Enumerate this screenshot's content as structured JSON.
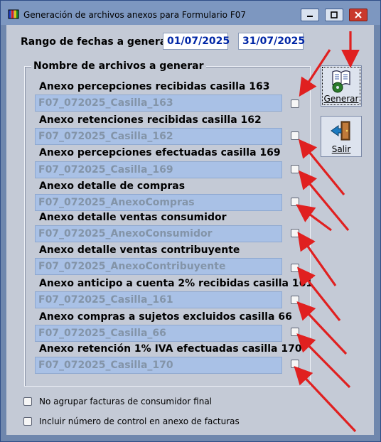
{
  "window": {
    "title": "Generación de archivos anexos para Formulario F07",
    "controls": [
      "minimize-icon",
      "maximize-icon",
      "close-icon"
    ]
  },
  "date_range": {
    "label": "Rango de fechas a generar",
    "from": "01/07/2025",
    "to": "31/07/2025"
  },
  "files_group": {
    "title": "Nombre de archivos a generar",
    "rows": [
      {
        "label": "Anexo percepciones recibidas casilla 163",
        "filename": "F07_072025_Casilla_163",
        "checked": false
      },
      {
        "label": "Anexo retenciones recibidas casilla 162",
        "filename": "F07_072025_Casilla_162",
        "checked": false
      },
      {
        "label": "Anexo percepciones efectuadas casilla 169",
        "filename": "F07_072025_Casilla_169",
        "checked": false
      },
      {
        "label": "Anexo detalle de compras",
        "filename": "F07_072025_AnexoCompras",
        "checked": false
      },
      {
        "label": "Anexo detalle ventas consumidor",
        "filename": "F07_072025_AnexoConsumidor",
        "checked": false
      },
      {
        "label": "Anexo detalle ventas contribuyente",
        "filename": "F07_072025_AnexoContribuyente",
        "checked": false
      },
      {
        "label": "Anexo anticipo a cuenta 2% recibidas casilla 161",
        "filename": "F07_072025_Casilla_161",
        "checked": false
      },
      {
        "label": "Anexo compras a sujetos excluidos casilla 66",
        "filename": "F07_072025_Casilla_66",
        "checked": false
      },
      {
        "label": "Anexo retención 1% IVA efectuadas casilla 170",
        "filename": "F07_072025_Casilla_170",
        "checked": false
      }
    ]
  },
  "buttons": {
    "generate": "Generar",
    "exit": "Salir"
  },
  "options": [
    {
      "label": "No agrupar facturas de consumidor final",
      "checked": false
    },
    {
      "label": "Incluir número de control en anexo de facturas",
      "checked": false
    }
  ],
  "colors": {
    "client_bg": "#c4cad6",
    "filename_field_bg": "#a9c1e6",
    "date_text": "#0026a6",
    "annotation_arrow": "#e02020"
  }
}
